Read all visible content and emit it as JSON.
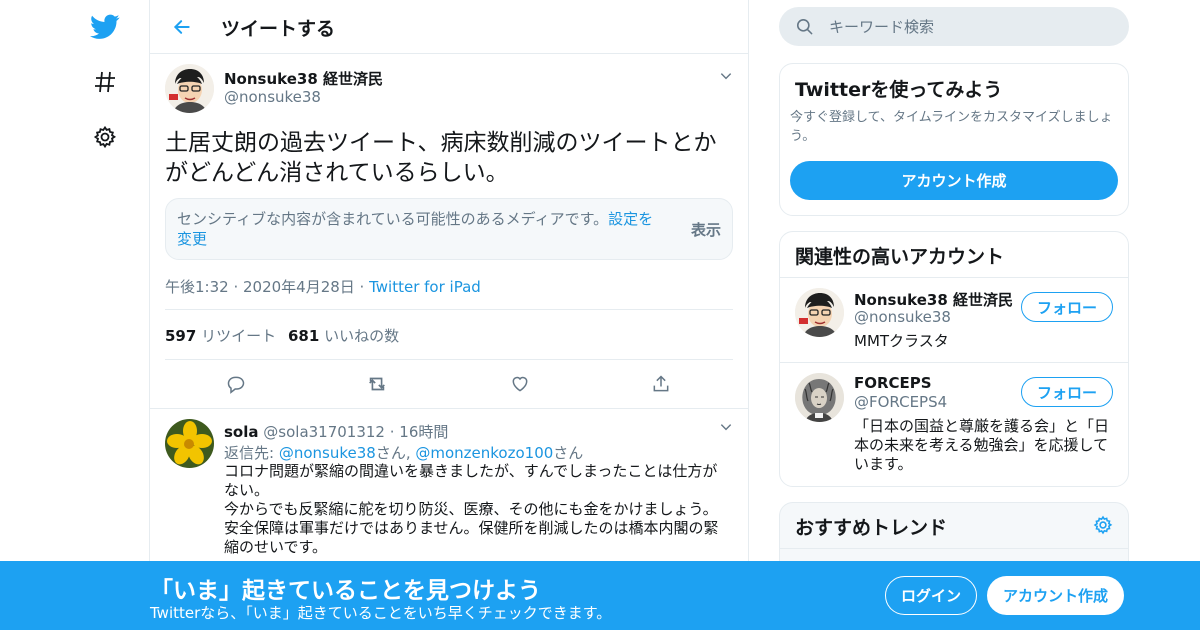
{
  "colors": {
    "accent": "#1da1f2",
    "link": "#1b95e0",
    "muted": "#657786",
    "border": "#e6ecf0",
    "text": "#14171a"
  },
  "nav": {
    "items": [
      {
        "icon": "twitter-bird-icon"
      },
      {
        "icon": "hashtag-icon"
      },
      {
        "icon": "gear-icon"
      }
    ]
  },
  "header": {
    "title": "ツイートする",
    "back_icon": "back-arrow-icon"
  },
  "tweet": {
    "author_name": "Nonsuke38 経世済民",
    "author_handle": "@nonsuke38",
    "text": "土居丈朗の過去ツイート、病床数削減のツイートとかがどんどん消されているらしい。",
    "sensitive_notice": "センシティブな内容が含まれている可能性のあるメディアです。",
    "sensitive_link": "設定を変更",
    "sensitive_show": "表示",
    "timestamp": "午後1:32 · 2020年4月28日 · ",
    "source": "Twitter for iPad",
    "retweets": "597",
    "retweets_label": "リツイート",
    "likes": "681",
    "likes_label": "いいねの数",
    "actions": [
      "reply-icon",
      "retweet-icon",
      "like-icon",
      "share-icon"
    ]
  },
  "reply": {
    "author_name": "sola",
    "author_handle": "@sola31701312",
    "time": " · 16時間",
    "reply_prefix": "返信先: ",
    "reply_to_1": "@nonsuke38",
    "reply_sep_1": "さん, ",
    "reply_to_2": "@monzenkozo100",
    "reply_sep_2": "さん",
    "text_lines": [
      "コロナ問題が緊縮の間違いを暴きましたが、すんでしまったことは仕方がない。",
      "今からでも反緊縮に舵を切り防災、医療、その他にも金をかけましょう。",
      "安全保障は軍事だけではありません。保健所を削減したのは橋本内閣の緊縮のせいです。"
    ]
  },
  "search": {
    "placeholder": "キーワード検索"
  },
  "signup_card": {
    "title": "Twitterを使ってみよう",
    "subtitle": "今すぐ登録して、タイムラインをカスタマイズしましょう。",
    "button": "アカウント作成"
  },
  "related": {
    "title": "関連性の高いアカウント",
    "accounts": [
      {
        "name": "Nonsuke38 経世済民",
        "handle": "@nonsuke38",
        "bio": "MMTクラスタ",
        "follow": "フォロー"
      },
      {
        "name": "FORCEPS",
        "handle": "@FORCEPS4",
        "bio": "「日本の国益と尊厳を護る会」と「日本の未来を考える勉強会」を応援しています。",
        "follow": "フォロー"
      }
    ]
  },
  "trends": {
    "title": "おすすめトレンド"
  },
  "banner": {
    "title": "「いま」起きていることを見つけよう",
    "subtitle": "Twitterなら、「いま」起きていることをいち早くチェックできます。",
    "login": "ログイン",
    "signup": "アカウント作成"
  }
}
